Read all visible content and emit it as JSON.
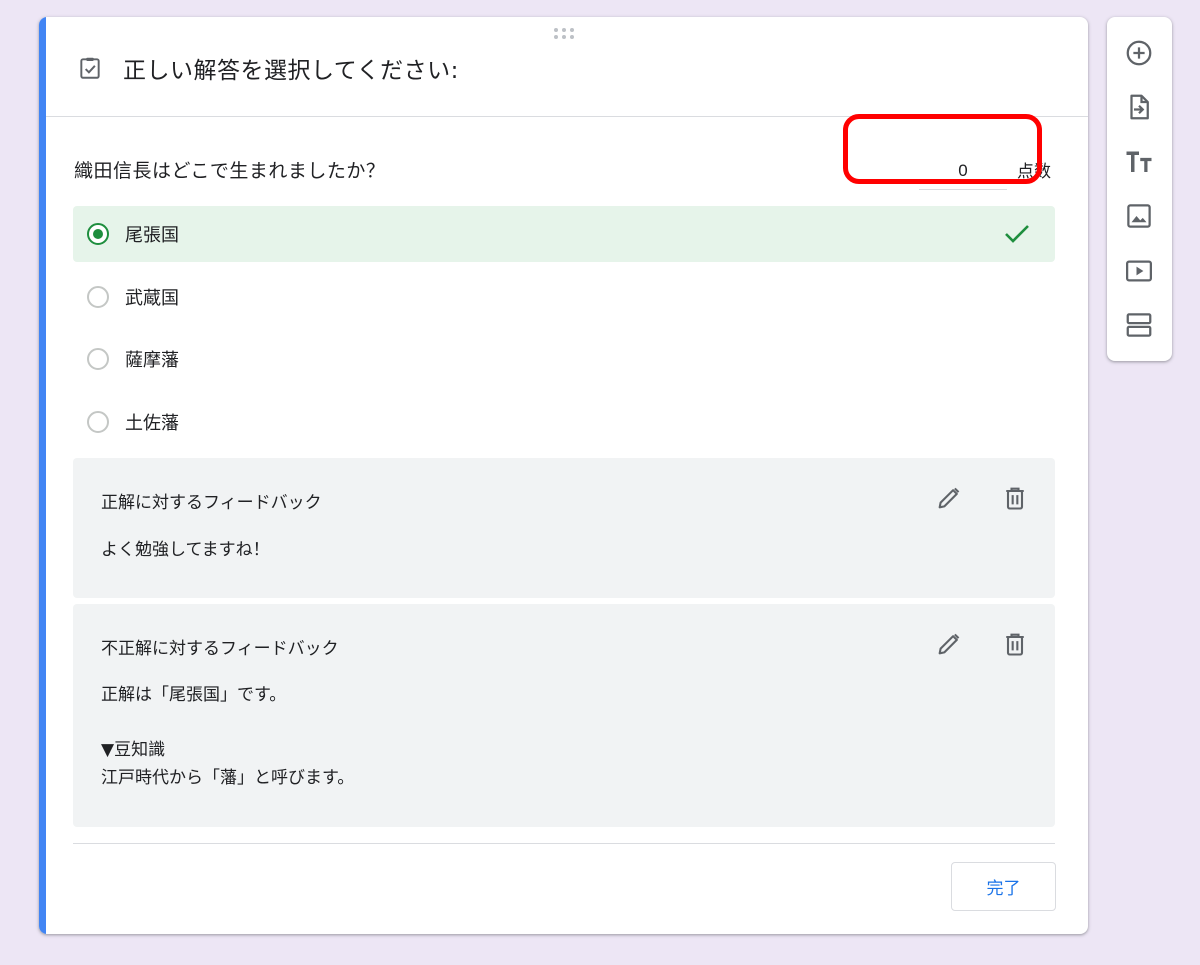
{
  "colors": {
    "accent": "#4285f4",
    "correct_bg": "#e6f4ea",
    "correct_green": "#1e8e3e",
    "highlight_red": "#ff0000",
    "link_blue": "#1a73e8"
  },
  "header": {
    "icon": "checklist-icon",
    "title": "正しい解答を選択してください:"
  },
  "question": {
    "text": "織田信長はどこで生まれましたか？",
    "points_value": "0",
    "points_label": "点数"
  },
  "options": [
    {
      "label": "尾張国",
      "selected": true,
      "correct": true
    },
    {
      "label": "武蔵国",
      "selected": false,
      "correct": false
    },
    {
      "label": "薩摩藩",
      "selected": false,
      "correct": false
    },
    {
      "label": "土佐藩",
      "selected": false,
      "correct": false
    }
  ],
  "feedback": {
    "correct": {
      "title": "正解に対するフィードバック",
      "body": "よく勉強してますね！"
    },
    "incorrect": {
      "title": "不正解に対するフィードバック",
      "body_line1": "正解は「尾張国」です。",
      "body_line2": "▼豆知識",
      "body_line3": "江戸時代から「藩」と呼びます。"
    }
  },
  "done_button": "完了",
  "toolbar": [
    "add-question-icon",
    "import-questions-icon",
    "add-title-icon",
    "add-image-icon",
    "add-video-icon",
    "add-section-icon"
  ]
}
